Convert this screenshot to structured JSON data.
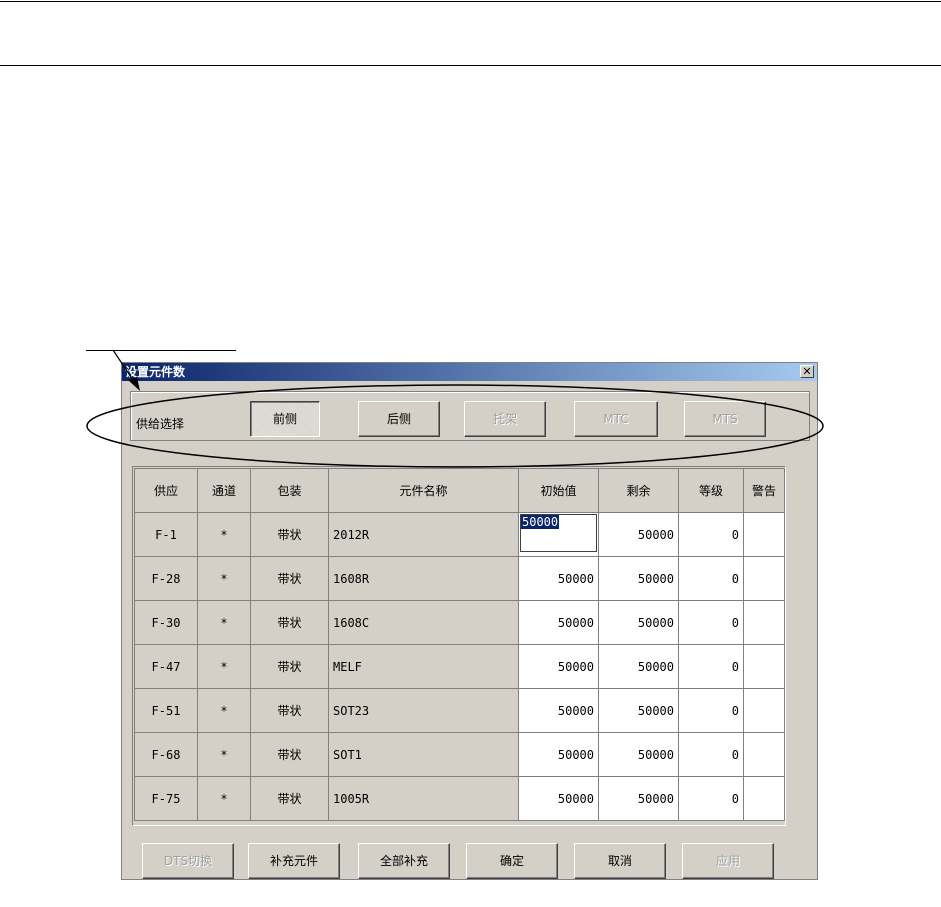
{
  "dialog": {
    "title": "设置元件数",
    "close_glyph": "✕"
  },
  "supply": {
    "label": "供给选择",
    "buttons": [
      {
        "label": "前侧",
        "state": "pressed"
      },
      {
        "label": "后侧",
        "state": "enabled"
      },
      {
        "label": "托架",
        "state": "disabled"
      },
      {
        "label": "MTC",
        "state": "disabled"
      },
      {
        "label": "MTS",
        "state": "disabled"
      }
    ]
  },
  "table": {
    "headers": [
      "供应",
      "通道",
      "包装",
      "元件名称",
      "初始值",
      "剩余",
      "等级",
      "警告"
    ],
    "rows": [
      {
        "supply": "F-1",
        "channel": "*",
        "package": "带状",
        "name": "2012R",
        "initial": "50000",
        "remain": "50000",
        "level": "0",
        "warn": ""
      },
      {
        "supply": "F-28",
        "channel": "*",
        "package": "带状",
        "name": "1608R",
        "initial": "50000",
        "remain": "50000",
        "level": "0",
        "warn": ""
      },
      {
        "supply": "F-30",
        "channel": "*",
        "package": "带状",
        "name": "1608C",
        "initial": "50000",
        "remain": "50000",
        "level": "0",
        "warn": ""
      },
      {
        "supply": "F-47",
        "channel": "*",
        "package": "带状",
        "name": "MELF",
        "initial": "50000",
        "remain": "50000",
        "level": "0",
        "warn": ""
      },
      {
        "supply": "F-51",
        "channel": "*",
        "package": "带状",
        "name": "SOT23",
        "initial": "50000",
        "remain": "50000",
        "level": "0",
        "warn": ""
      },
      {
        "supply": "F-68",
        "channel": "*",
        "package": "带状",
        "name": "SOT1",
        "initial": "50000",
        "remain": "50000",
        "level": "0",
        "warn": ""
      },
      {
        "supply": "F-75",
        "channel": "*",
        "package": "带状",
        "name": "1005R",
        "initial": "50000",
        "remain": "50000",
        "level": "0",
        "warn": ""
      }
    ]
  },
  "footer": {
    "buttons": [
      {
        "label": "DTS切换",
        "state": "disabled"
      },
      {
        "label": "补充元件",
        "state": "enabled"
      },
      {
        "label": "全部补充",
        "state": "enabled"
      },
      {
        "label": "确定",
        "state": "enabled"
      },
      {
        "label": "取消",
        "state": "enabled"
      },
      {
        "label": "应用",
        "state": "disabled"
      }
    ]
  },
  "colors": {
    "dialog_bg": "#d4d0c8",
    "titlebar_start": "#0a246a",
    "titlebar_end": "#a6caf0",
    "selection": "#0a246a"
  }
}
